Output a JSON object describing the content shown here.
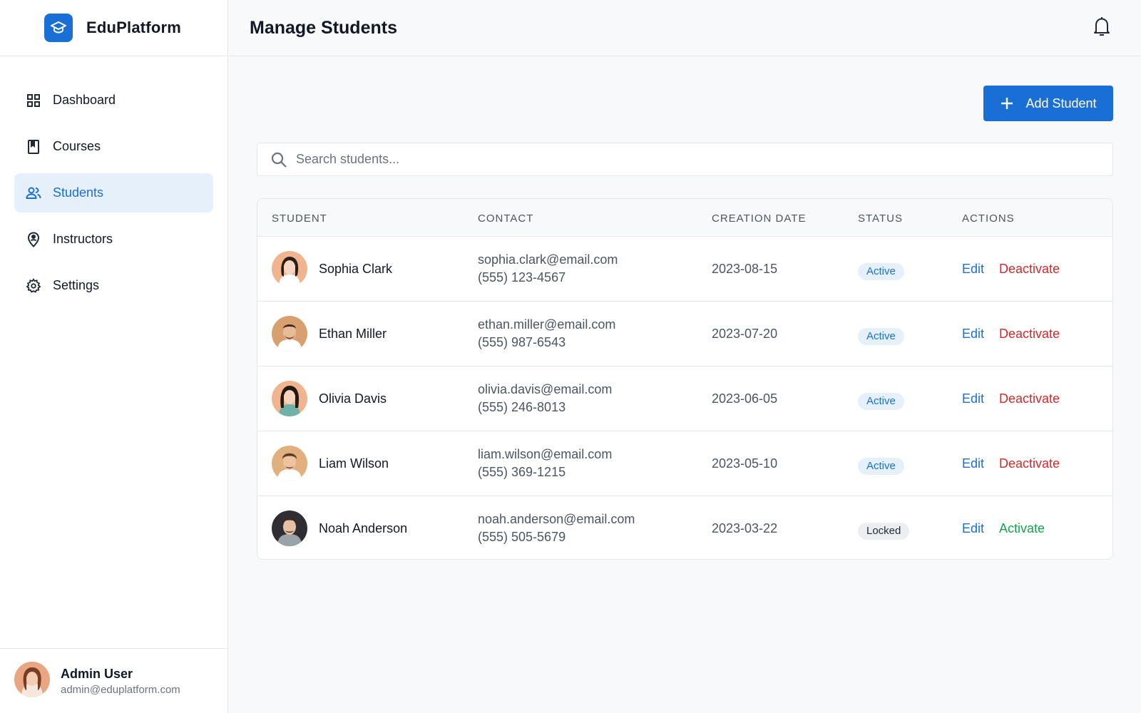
{
  "brand": {
    "name": "EduPlatform",
    "logo_icon": "graduation-cap-icon",
    "accent": "#1a6fd6"
  },
  "sidebar": {
    "items": [
      {
        "label": "Dashboard",
        "icon": "dashboard-grid-icon",
        "active": false
      },
      {
        "label": "Courses",
        "icon": "book-icon",
        "active": false
      },
      {
        "label": "Students",
        "icon": "users-icon",
        "active": true
      },
      {
        "label": "Instructors",
        "icon": "location-person-icon",
        "active": false
      },
      {
        "label": "Settings",
        "icon": "gear-icon",
        "active": false
      }
    ],
    "user": {
      "name": "Admin User",
      "email": "admin@eduplatform.com"
    }
  },
  "header": {
    "title": "Manage Students",
    "notification_icon": "bell-icon"
  },
  "toolbar": {
    "add_label": "Add Student"
  },
  "search": {
    "placeholder": "Search students..."
  },
  "table": {
    "columns": [
      "STUDENT",
      "CONTACT",
      "CREATION DATE",
      "STATUS",
      "ACTIONS"
    ],
    "rows": [
      {
        "name": "Sophia Clark",
        "email": "sophia.clark@email.com",
        "phone": "(555) 123-4567",
        "date": "2023-08-15",
        "status": "Active",
        "edit": "Edit",
        "toggle": "Deactivate"
      },
      {
        "name": "Ethan Miller",
        "email": "ethan.miller@email.com",
        "phone": "(555) 987-6543",
        "date": "2023-07-20",
        "status": "Active",
        "edit": "Edit",
        "toggle": "Deactivate"
      },
      {
        "name": "Olivia Davis",
        "email": "olivia.davis@email.com",
        "phone": "(555) 246-8013",
        "date": "2023-06-05",
        "status": "Active",
        "edit": "Edit",
        "toggle": "Deactivate"
      },
      {
        "name": "Liam Wilson",
        "email": "liam.wilson@email.com",
        "phone": "(555) 369-1215",
        "date": "2023-05-10",
        "status": "Active",
        "edit": "Edit",
        "toggle": "Deactivate"
      },
      {
        "name": "Noah Anderson",
        "email": "noah.anderson@email.com",
        "phone": "(555) 505-5679",
        "date": "2023-03-22",
        "status": "Locked",
        "edit": "Edit",
        "toggle": "Activate"
      }
    ]
  },
  "colors": {
    "active_badge": "#1a6fd6",
    "deactivate": "#dc2626",
    "activate": "#16a34a"
  }
}
